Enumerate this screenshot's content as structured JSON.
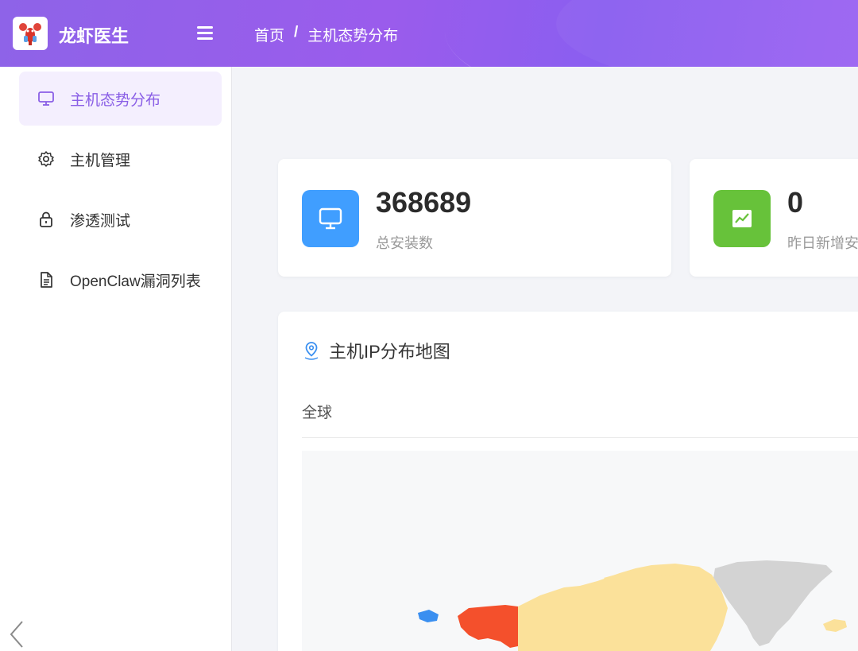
{
  "app": {
    "title": "龙虾医生"
  },
  "breadcrumb": {
    "home": "首页",
    "separator": "/",
    "current": "主机态势分布"
  },
  "sidebar": {
    "items": [
      {
        "label": "主机态势分布",
        "icon": "monitor-icon",
        "active": true
      },
      {
        "label": "主机管理",
        "icon": "gear-icon",
        "active": false
      },
      {
        "label": "渗透测试",
        "icon": "lock-icon",
        "active": false
      },
      {
        "label": "OpenClaw漏洞列表",
        "icon": "document-icon",
        "active": false
      }
    ]
  },
  "stats": [
    {
      "value": "368689",
      "label": "总安装数",
      "icon": "monitor-icon",
      "color": "#409eff"
    },
    {
      "value": "0",
      "label": "昨日新增安装",
      "icon": "trend-chart-icon",
      "color": "#67c23a"
    }
  ],
  "map": {
    "title": "主机IP分布地图",
    "tab": "全球",
    "icon": "location-pin-icon"
  },
  "colors": {
    "accent": "#8a5fe6",
    "header_start": "#8e63e8",
    "header_end": "#9b63f2",
    "map_highlight": "#f4502c",
    "map_medium": "#fbe19a",
    "map_low": "#3a8ff0",
    "map_none": "#d3d3d3"
  }
}
